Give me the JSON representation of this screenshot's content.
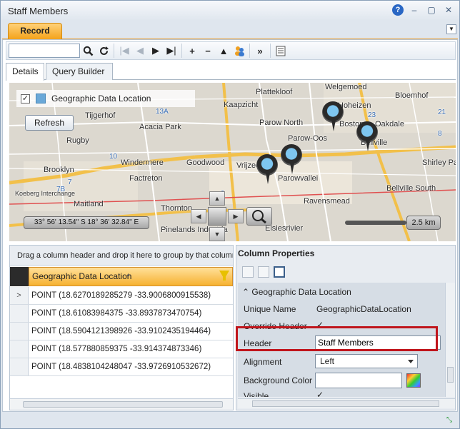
{
  "window": {
    "title": "Staff Members",
    "help": "?",
    "minimize": "–",
    "restore": "▢",
    "close": "✕"
  },
  "tabs": {
    "record": "Record",
    "dropdown": "▼"
  },
  "toolbar": {
    "search_value": "",
    "icons": [
      "search-icon",
      "refresh-icon",
      "first-icon",
      "previous-icon",
      "next-icon",
      "last-icon",
      "add-icon",
      "remove-icon",
      "up-icon",
      "users-icon",
      "more-icon",
      "form-icon"
    ]
  },
  "subtabs": {
    "details": "Details",
    "query_builder": "Query Builder"
  },
  "map": {
    "legend_label": "Geographic Data Location",
    "legend_checked": "✓",
    "refresh_label": "Refresh",
    "coordinates": "33° 56' 13.54\" S 18° 36' 32.84\" E",
    "scale": "2.5 km",
    "places": [
      {
        "name": "Plattekloof"
      },
      {
        "name": "Welgemoed"
      },
      {
        "name": "Bloemhof"
      },
      {
        "name": "Kaapzicht"
      },
      {
        "name": "Hoheizen"
      },
      {
        "name": "Tijgerhof"
      },
      {
        "name": "Parow North"
      },
      {
        "name": "Boston"
      },
      {
        "name": "Oakdale"
      },
      {
        "name": "Acacia Park"
      },
      {
        "name": "Parow-Oos"
      },
      {
        "name": "Rugby"
      },
      {
        "name": "Bellville"
      },
      {
        "name": "Brooklyn"
      },
      {
        "name": "Windermere"
      },
      {
        "name": "Goodwood"
      },
      {
        "name": "Vrijzee"
      },
      {
        "name": "Parowvallei"
      },
      {
        "name": "Shirley Pa"
      },
      {
        "name": "Factreton"
      },
      {
        "name": "Bellville South"
      },
      {
        "name": "Maitland"
      },
      {
        "name": "Ravensmead"
      },
      {
        "name": "Thornton"
      },
      {
        "name": "Elsiesrivier"
      },
      {
        "name": "Pinelands Industria"
      },
      {
        "name": "Koeberg Interchange"
      }
    ],
    "route_labels": [
      "13A",
      "10",
      "7",
      "7B",
      "9",
      "23",
      "21",
      "8"
    ]
  },
  "grid": {
    "group_hint": "Drag a column header and drop it here to group by that column",
    "column": "Geographic Data Location",
    "sort_indicator": "▲",
    "row_indicator": ">",
    "rows": [
      "POINT (18.6270189285279 -33.9006800915538)",
      "POINT (18.61083984375 -33.8937873470754)",
      "POINT (18.5904121398926 -33.9102435194464)",
      "POINT (18.577880859375 -33.914374873346)",
      "POINT (18.4838104248047 -33.9726910532672)"
    ]
  },
  "properties": {
    "title": "Column Properties",
    "section": "Geographic Data Location",
    "unique_name_label": "Unique Name",
    "unique_name_value": "GeographicDataLocation",
    "override_header_label": "Override Header",
    "override_header_checked": "✓",
    "header_label": "Header",
    "header_value": "Staff Members",
    "alignment_label": "Alignment",
    "alignment_value": "Left",
    "background_color_label": "Background Color",
    "visible_label": "Visible",
    "visible_checked": "✓"
  },
  "colors": {
    "accent": "#f4a21a",
    "highlight": "#c0151c",
    "pin": "#7ec6f0"
  }
}
